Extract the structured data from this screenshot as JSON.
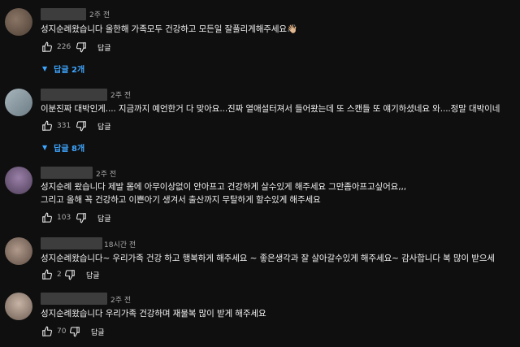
{
  "comments": [
    {
      "time": "2주 전",
      "text": "성지순례왔습니다 올한해 가족모두 건강하고 모든일 잘풀리게해주세요👋🏼",
      "likes": "226",
      "reply_label": "답글",
      "replies_label": "답글 2개",
      "avatar_color": "#6b5a4e"
    },
    {
      "time": "2주 전",
      "text": "이분진짜 대박인게.... 지금까지 예언한거 다 맞아요...진짜 열애설터져서 들어왔는데 또 스캔들 또 얘기하셨네요 와....정말 대박이네",
      "likes": "331",
      "reply_label": "답글",
      "replies_label": "답글 8개",
      "avatar_color": "#8a9aa3"
    },
    {
      "time": "2주 전",
      "text_lines": [
        "성지순례 왔습니다 제발 몸에 아무이상없이 안아프고 건강하게 살수있게 해주세요 그만좀아프고싶어요,,,",
        "그리고 올해 꼭 건강하고 이쁜아기 생겨서 출산까지 무탈하게 할수있게 해주세요"
      ],
      "likes": "103",
      "reply_label": "답글",
      "avatar_color": "#6e5a78"
    },
    {
      "time": "18시간 전",
      "text": "성지순례왔습니다~ 우리가족 건강 하고 행복하게 해주세요 ~ 좋은생각과 잘 살아갈수있게 해주세요~ 감사합니다 복 많이 받으세",
      "likes": "2",
      "reply_label": "답글",
      "avatar_color": "#8c7a6e"
    },
    {
      "time": "2주 전",
      "text": "성지순례왔습니다  우리가족 건강하며  재물복 많이 받게 해주세요",
      "likes": "70",
      "reply_label": "답글",
      "avatar_color": "#a8968a"
    }
  ],
  "colors": {
    "background": "#0f0f0f",
    "text": "#f1f1f1",
    "secondary_text": "#aaaaaa",
    "accent": "#3ea6ff"
  },
  "icons": [
    "thumb-up-icon",
    "thumb-down-icon",
    "caret-down-icon"
  ]
}
